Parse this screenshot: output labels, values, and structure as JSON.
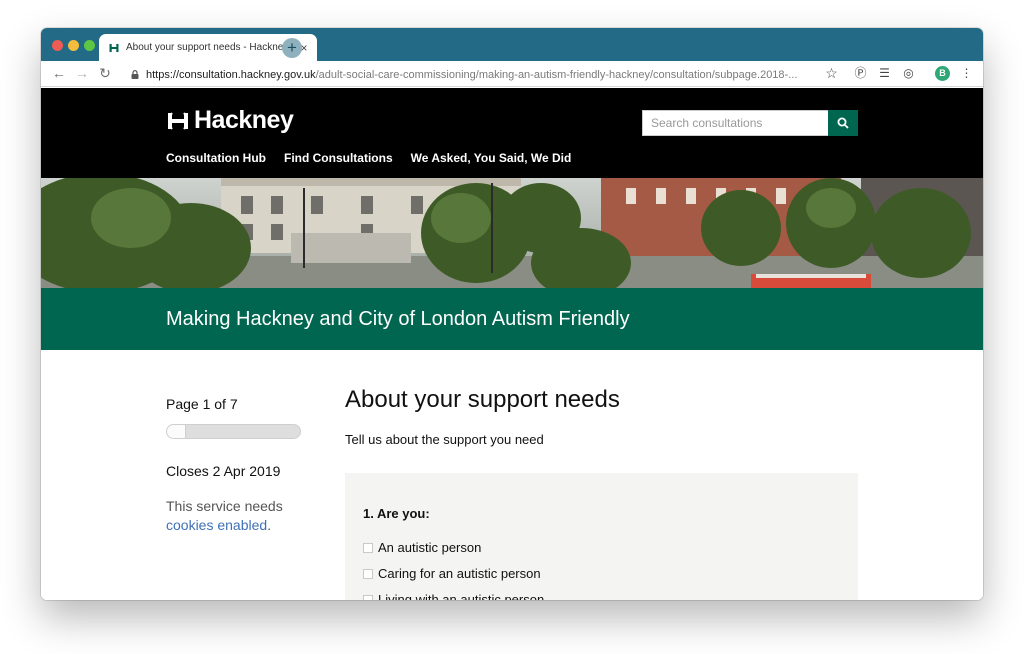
{
  "browser": {
    "tab_title": "About your support needs - Hackney",
    "new_tab_symbol": "+",
    "close_symbol": "×",
    "url_host": "https://consultation.hackney.gov.uk",
    "url_path": "/adult-social-care-commissioning/making-an-autism-friendly-hackney/consultation/subpage.2018-...",
    "avatar_initial": "B"
  },
  "header": {
    "logo_text": "Hackney",
    "search_placeholder": "Search consultations",
    "nav": [
      "Consultation Hub",
      "Find Consultations",
      "We Asked, You Said, We Did"
    ]
  },
  "banner": {
    "title": "Making Hackney and City of London Autism Friendly"
  },
  "sidebar": {
    "page_count": "Page 1 of 7",
    "progress_fraction": 0.14,
    "closes": "Closes 2 Apr 2019",
    "cookie_text": "This service needs ",
    "cookie_link": "cookies enabled",
    "cookie_suffix": "."
  },
  "main": {
    "heading": "About your support needs",
    "intro": "Tell us about the support you need",
    "question": "1. Are you:",
    "options": [
      "An autistic person",
      "Caring for an autistic person",
      "Living with an autistic person"
    ]
  },
  "colors": {
    "brand_green": "#00664f",
    "titlebar": "#226a85",
    "link": "#3f71b7"
  }
}
